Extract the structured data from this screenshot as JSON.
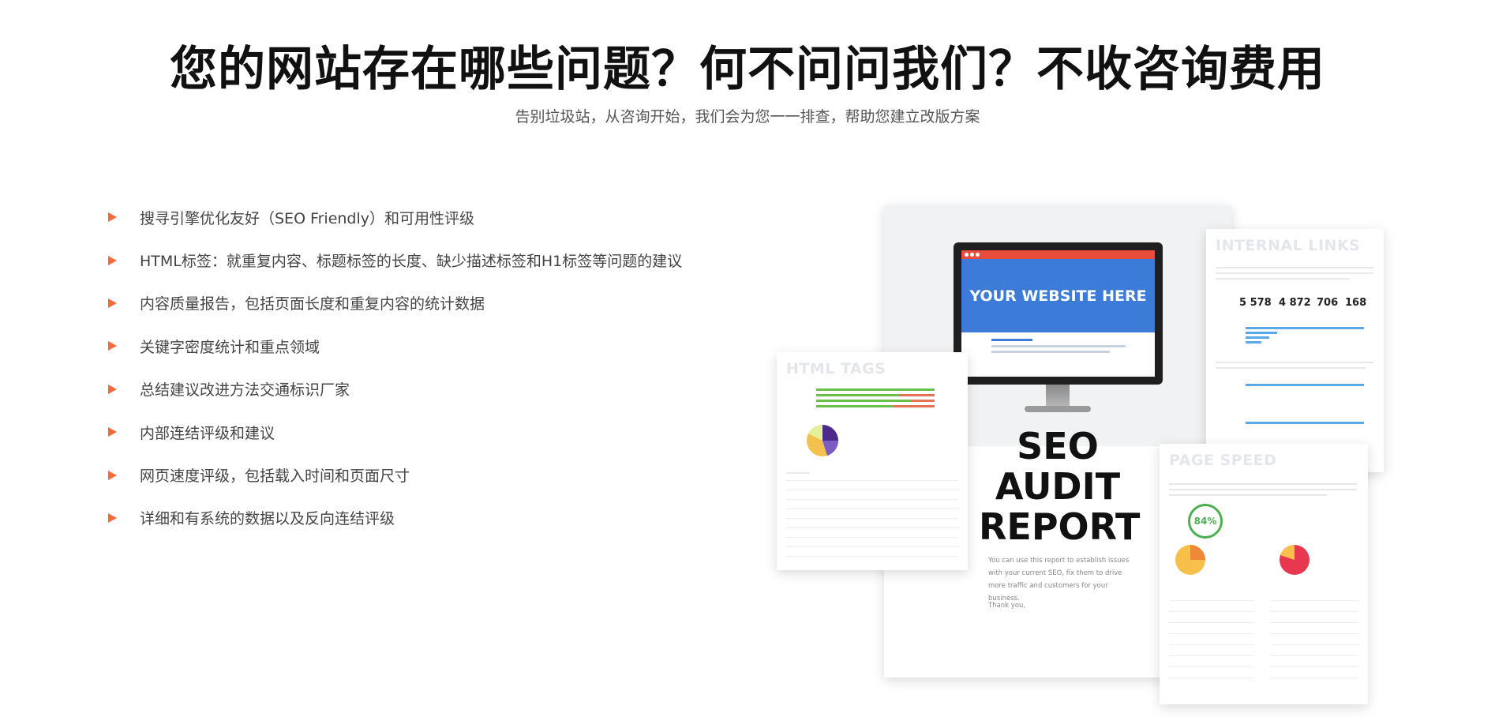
{
  "header": {
    "title": "您的网站存在哪些问题？何不问问我们？不收咨询费用",
    "subtitle": "告别垃圾站，从咨询开始，我们会为您一一排查，帮助您建立改版方案"
  },
  "features": [
    "搜寻引擎优化友好（SEO Friendly）和可用性评级",
    "HTML标签：就重复内容、标题标签的长度、缺少描述标签和H1标签等问题的建议",
    "内容质量报告，包括页面长度和重复内容的统计数据",
    "关键字密度统计和重点领域",
    "总结建议改进方法交通标识厂家",
    "内部连结评级和建议",
    "网页速度评级，包括载入时间和页面尺寸",
    "详细和有系统的数据以及反向连结评级"
  ],
  "report": {
    "cover": {
      "screen_text": "YOUR WEBSITE HERE",
      "title_line1": "SEO",
      "title_line2": "AUDIT",
      "title_line3": "REPORT",
      "body": "You can use this report to establish issues with your current SEO, fix them to drive more traffic and customers for your business.",
      "thanks": "Thank you,"
    },
    "html_tags": {
      "title": "HTML TAGS"
    },
    "internal_links": {
      "title": "INTERNAL LINKS",
      "stats": [
        "5 578",
        "4 872",
        "706",
        "168"
      ]
    },
    "page_speed": {
      "title": "PAGE SPEED",
      "score": "84%"
    }
  },
  "colors": {
    "accent": "#f26b3a",
    "screen_blue": "#3d7bd9",
    "browser_red": "#e74c3c",
    "ok_green": "#4caf50"
  }
}
